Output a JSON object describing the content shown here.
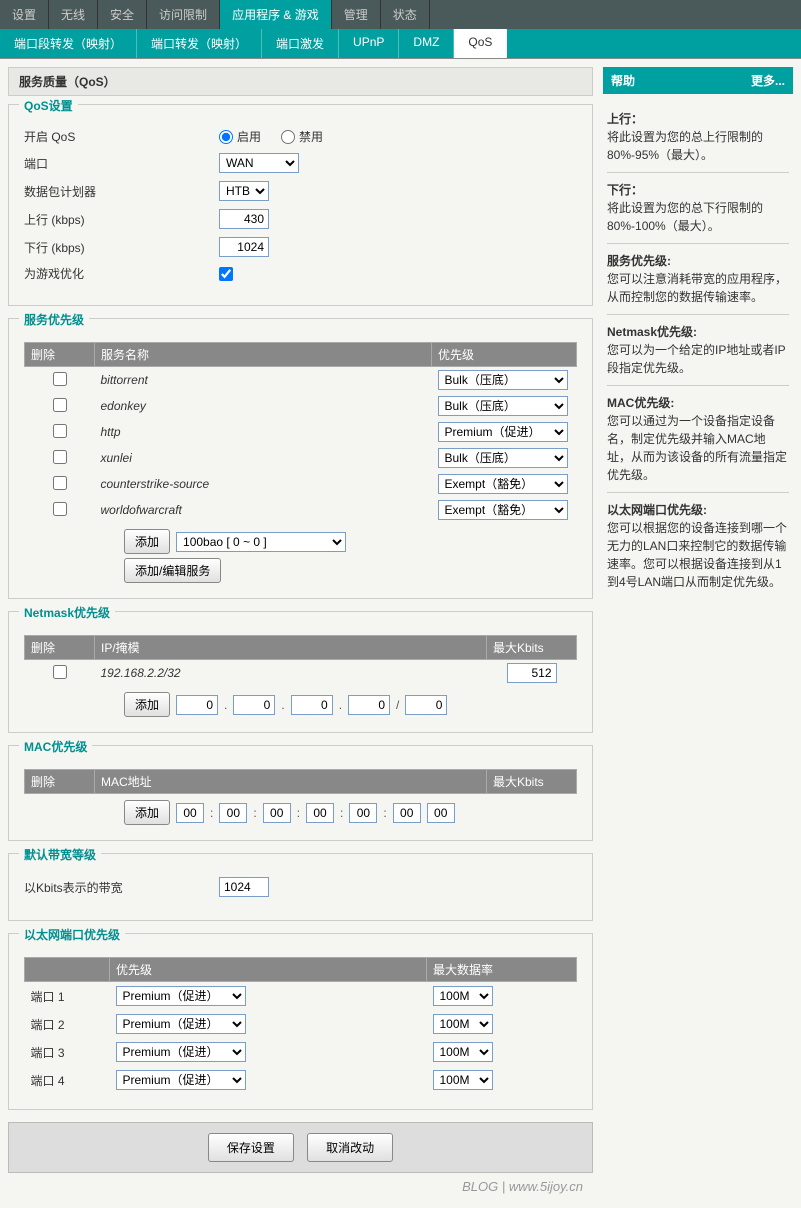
{
  "top_tabs": [
    "设置",
    "无线",
    "安全",
    "访问限制",
    "应用程序 & 游戏",
    "管理",
    "状态"
  ],
  "top_tab_active": 4,
  "sub_tabs": [
    "端口段转发（映射）",
    "端口转发（映射）",
    "端口激发",
    "UPnP",
    "DMZ",
    "QoS"
  ],
  "sub_tab_active": 5,
  "page_title": "服务质量（QoS）",
  "qos_settings": {
    "legend": "QoS设置",
    "enable_label": "开启 QoS",
    "enable_opt": "启用",
    "disable_opt": "禁用",
    "port_label": "端口",
    "port_value": "WAN",
    "scheduler_label": "数据包计划器",
    "scheduler_value": "HTB",
    "uplink_label": "上行 (kbps)",
    "uplink_value": "430",
    "downlink_label": "下行 (kbps)",
    "downlink_value": "1024",
    "gaming_label": "为游戏优化"
  },
  "service_prio": {
    "legend": "服务优先级",
    "col_delete": "删除",
    "col_service": "服务名称",
    "col_priority": "优先级",
    "rows": [
      {
        "name": "bittorrent",
        "prio": "Bulk（压底）"
      },
      {
        "name": "edonkey",
        "prio": "Bulk（压底）"
      },
      {
        "name": "http",
        "prio": "Premium（促进）"
      },
      {
        "name": "xunlei",
        "prio": "Bulk（压底）"
      },
      {
        "name": "counterstrike-source",
        "prio": "Exempt（豁免）"
      },
      {
        "name": "worldofwarcraft",
        "prio": "Exempt（豁免）"
      }
    ],
    "add_btn": "添加",
    "add_option": "100bao [ 0 ~ 0 ]",
    "edit_btn": "添加/编辑服务"
  },
  "netmask_prio": {
    "legend": "Netmask优先级",
    "col_delete": "删除",
    "col_ip": "IP/掩模",
    "col_max": "最大Kbits",
    "row_ip": "192.168.2.2/32",
    "row_max": "512",
    "add_btn": "添加",
    "ip_a": "0",
    "ip_b": "0",
    "ip_c": "0",
    "ip_d": "0",
    "ip_m": "0"
  },
  "mac_prio": {
    "legend": "MAC优先级",
    "col_delete": "删除",
    "col_mac": "MAC地址",
    "col_max": "最大Kbits",
    "add_btn": "添加",
    "m1": "00",
    "m2": "00",
    "m3": "00",
    "m4": "00",
    "m5": "00",
    "m6": "00",
    "maxk": "00"
  },
  "default_bw": {
    "legend": "默认带宽等级",
    "label": "以Kbits表示的带宽",
    "value": "1024"
  },
  "eth_prio": {
    "legend": "以太网端口优先级",
    "col_prio": "优先级",
    "col_rate": "最大数据率",
    "ports": [
      {
        "label": "端口 1",
        "prio": "Premium（促进）",
        "rate": "100M"
      },
      {
        "label": "端口 2",
        "prio": "Premium（促进）",
        "rate": "100M"
      },
      {
        "label": "端口 3",
        "prio": "Premium（促进）",
        "rate": "100M"
      },
      {
        "label": "端口 4",
        "prio": "Premium（促进）",
        "rate": "100M"
      }
    ]
  },
  "bottom": {
    "save": "保存设置",
    "cancel": "取消改动"
  },
  "help": {
    "header": "帮助",
    "more": "更多...",
    "sections": [
      {
        "title": "上行：",
        "text": "将此设置为您的总上行限制的80%-95%（最大）。"
      },
      {
        "title": "下行：",
        "text": "将此设置为您的总下行限制的80%-100%（最大）。"
      },
      {
        "title": "服务优先级:",
        "text": "您可以注意消耗带宽的应用程序，从而控制您的数据传输速率。"
      },
      {
        "title": "Netmask优先级:",
        "text": "您可以为一个给定的IP地址或者IP段指定优先级。"
      },
      {
        "title": "MAC优先级:",
        "text": "您可以通过为一个设备指定设备名，制定优先级并输入MAC地址，从而为该设备的所有流量指定优先级。"
      },
      {
        "title": "以太网端口优先级:",
        "text": "您可以根据您的设备连接到哪一个无力的LAN口来控制它的数据传输速率。您可以根据设备连接到从1到4号LAN端口从而制定优先级。"
      }
    ]
  },
  "watermark": "BLOG | www.5ijoy.cn"
}
